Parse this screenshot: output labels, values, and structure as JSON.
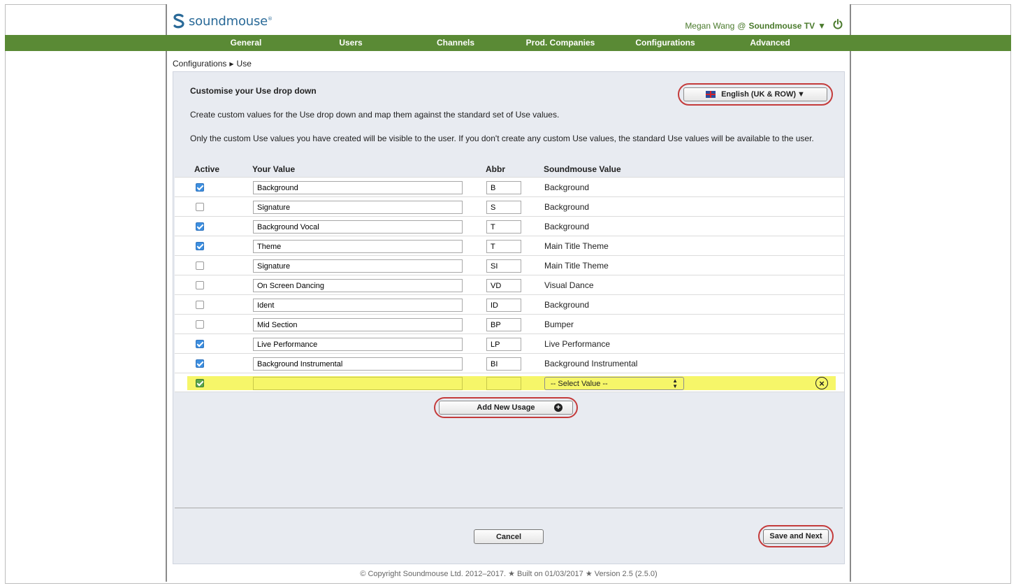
{
  "header": {
    "logo_text": "soundmouse",
    "logo_mark": "®",
    "user_name": "Megan Wang",
    "at": "@",
    "org": "Soundmouse TV",
    "org_caret": "▼",
    "power_icon": "power-icon"
  },
  "nav": {
    "items": [
      "General",
      "Users",
      "Channels",
      "Prod. Companies",
      "Configurations",
      "Advanced"
    ]
  },
  "breadcrumb": {
    "parent": "Configurations",
    "separator": "▶",
    "current": "Use"
  },
  "panel": {
    "title": "Customise your Use drop down",
    "desc1": "Create custom values for the Use drop down and map them against the standard set of Use values.",
    "desc2": "Only the custom Use values you have created will be visible to the user. If you don't create any custom Use values, the standard Use values will be available to the user.",
    "language": "English (UK & ROW)",
    "language_caret": "▼"
  },
  "table": {
    "headers": {
      "active": "Active",
      "your_value": "Your Value",
      "abbr": "Abbr",
      "soundmouse_value": "Soundmouse Value"
    },
    "rows": [
      {
        "active": true,
        "value": "Background",
        "abbr": "B",
        "soundmouse": "Background"
      },
      {
        "active": false,
        "value": "Signature",
        "abbr": "S",
        "soundmouse": "Background"
      },
      {
        "active": true,
        "value": "Background Vocal",
        "abbr": "T",
        "soundmouse": "Background"
      },
      {
        "active": true,
        "value": "Theme",
        "abbr": "T",
        "soundmouse": "Main Title Theme"
      },
      {
        "active": false,
        "value": "Signature",
        "abbr": "SI",
        "soundmouse": "Main Title Theme"
      },
      {
        "active": false,
        "value": "On Screen Dancing",
        "abbr": "VD",
        "soundmouse": "Visual Dance"
      },
      {
        "active": false,
        "value": "Ident",
        "abbr": "ID",
        "soundmouse": "Background"
      },
      {
        "active": false,
        "value": "Mid Section",
        "abbr": "BP",
        "soundmouse": "Bumper"
      },
      {
        "active": true,
        "value": "Live Performance",
        "abbr": "LP",
        "soundmouse": "Live Performance"
      },
      {
        "active": true,
        "value": "Background Instrumental",
        "abbr": "BI",
        "soundmouse": "Background Instrumental"
      }
    ],
    "new_row": {
      "active": true,
      "value": "",
      "abbr": "",
      "select_placeholder": "-- Select Value --"
    }
  },
  "actions": {
    "add_new": "Add New Usage",
    "cancel": "Cancel",
    "save_next": "Save and Next"
  },
  "footer": {
    "text": "© Copyright Soundmouse Ltd. 2012–2017. ★ Built on 01/03/2017 ★ Version 2.5 (2.5.0)"
  },
  "colors": {
    "nav_green": "#5a8a35",
    "highlight_yellow": "#f6f669",
    "callout_red": "#c43b3b",
    "brand_blue": "#2a6a98"
  }
}
